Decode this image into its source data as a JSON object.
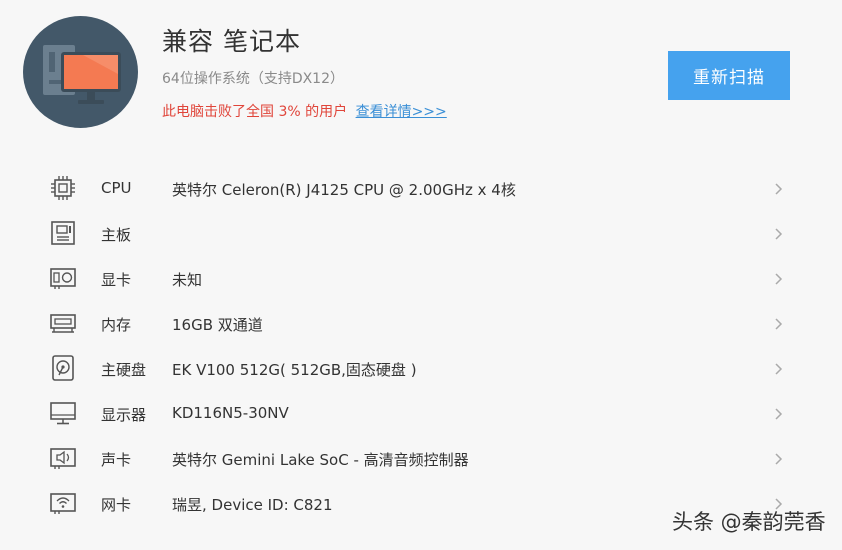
{
  "header": {
    "title": "兼容 笔记本",
    "subtitle": "64位操作系统（支持DX12）",
    "rank_text": "此电脑击败了全国 3% 的用户",
    "details_link": "查看详情>>>",
    "rescan_button": "重新扫描"
  },
  "hardware": [
    {
      "icon": "cpu-icon",
      "label": "CPU",
      "value": "英特尔 Celeron(R) J4125 CPU @ 2.00GHz x 4核"
    },
    {
      "icon": "motherboard-icon",
      "label": "主板",
      "value": ""
    },
    {
      "icon": "graphics-card-icon",
      "label": "显卡",
      "value": "未知"
    },
    {
      "icon": "memory-icon",
      "label": "内存",
      "value": "16GB 双通道"
    },
    {
      "icon": "hard-disk-icon",
      "label": "主硬盘",
      "value": "EK V100 512G( 512GB,固态硬盘 )"
    },
    {
      "icon": "monitor-icon",
      "label": "显示器",
      "value": "KD116N5-30NV"
    },
    {
      "icon": "sound-card-icon",
      "label": "声卡",
      "value": "英特尔 Gemini Lake SoC - 高清音频控制器"
    },
    {
      "icon": "network-card-icon",
      "label": "网卡",
      "value": "瑞昱, Device ID: C821"
    }
  ],
  "watermark": "头条 @秦韵莞香",
  "colors": {
    "accent": "#45a2ee",
    "warning_text": "#e0453a",
    "link": "#3a8fd6",
    "avatar_bg": "#435869",
    "monitor_orange": "#f47a52"
  }
}
